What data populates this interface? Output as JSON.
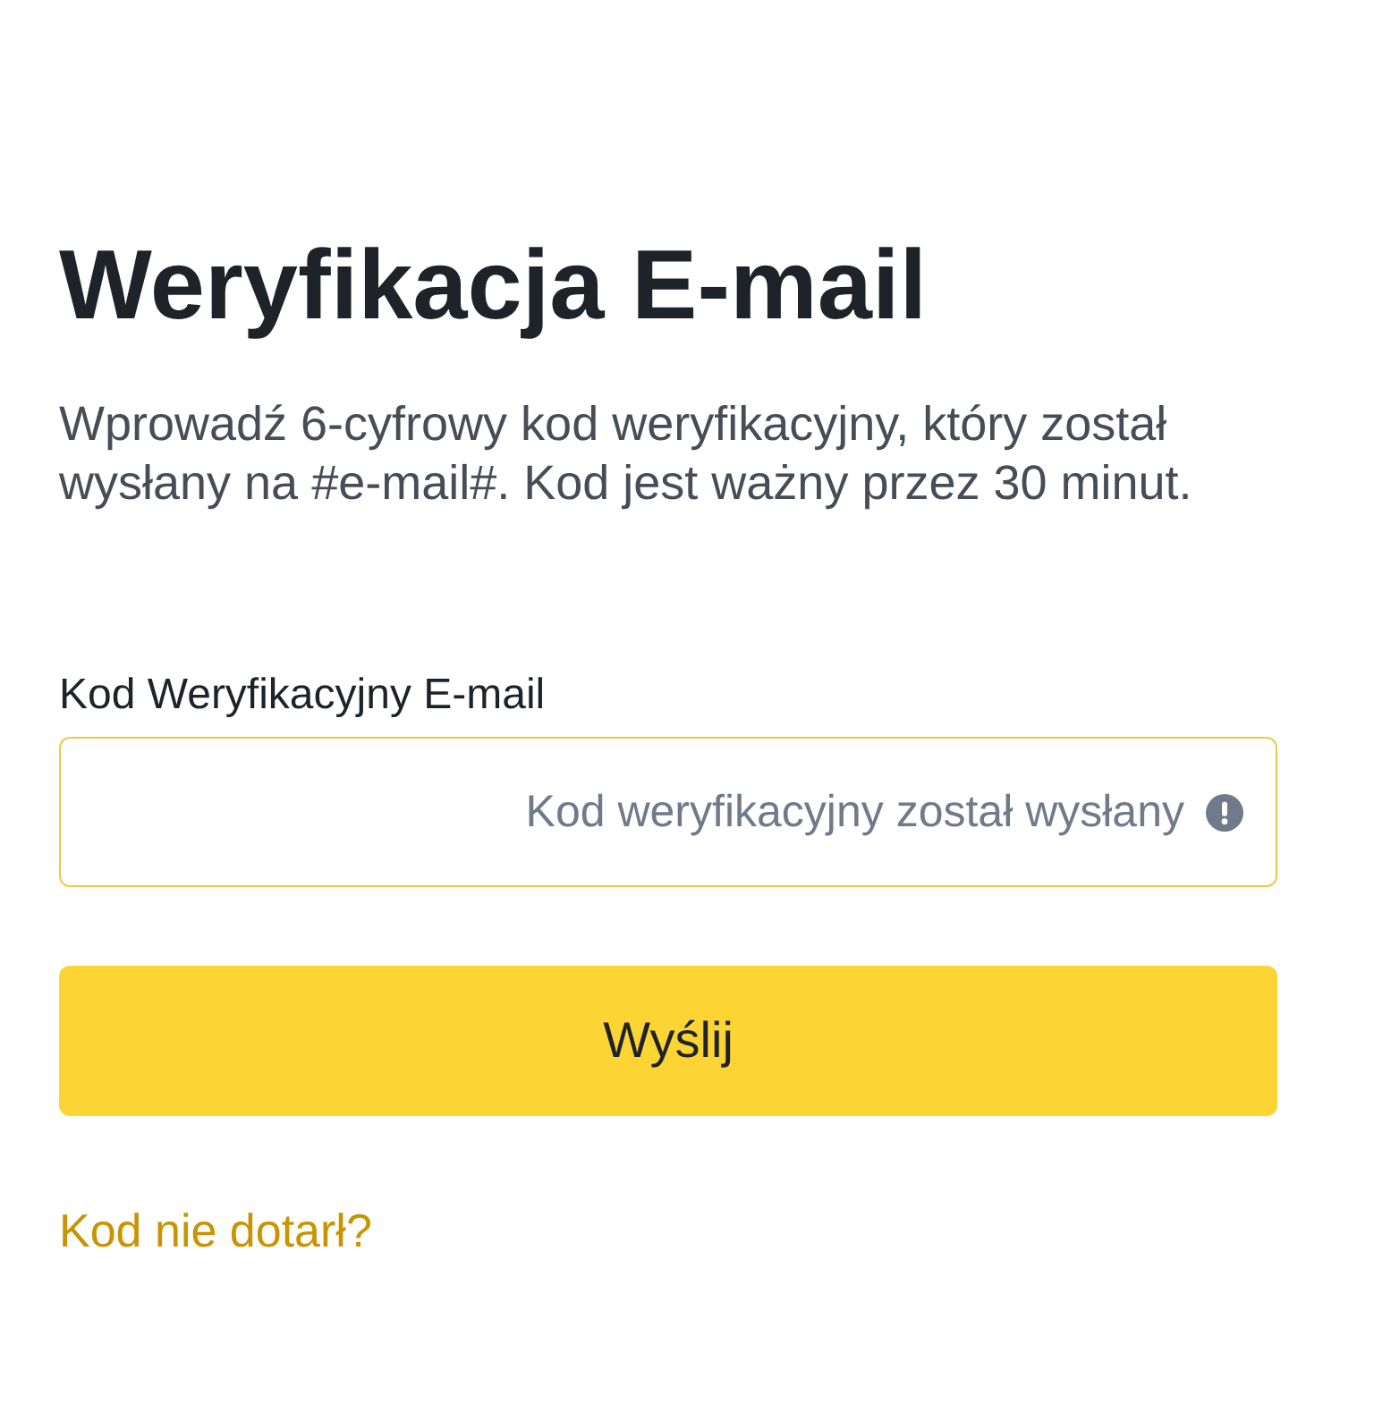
{
  "heading": "Weryfikacja E-mail",
  "description": "Wprowadź 6-cyfrowy kod weryfikacyjny, który został wysłany na #e-mail#. Kod jest ważny przez 30 minut.",
  "code_field": {
    "label": "Kod Weryfikacyjny E-mail",
    "status": "Kod weryfikacyjny został wysłany",
    "focused": true
  },
  "submit_button": "Wyślij",
  "resend_link": "Kod nie dotarł?"
}
